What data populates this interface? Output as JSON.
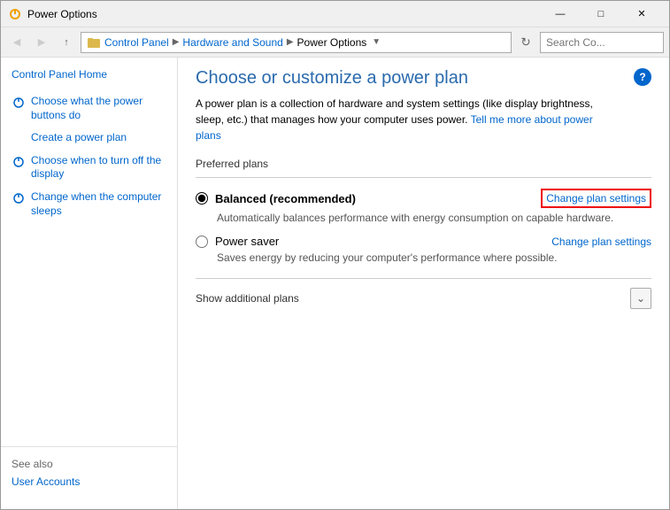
{
  "window": {
    "title": "Power Options",
    "titlebar_icon": "⚡",
    "controls": {
      "minimize": "—",
      "maximize": "□",
      "close": "✕"
    }
  },
  "toolbar": {
    "back_label": "◀",
    "forward_label": "▶",
    "up_label": "↑",
    "breadcrumb": [
      {
        "label": "Control Panel",
        "id": "control-panel"
      },
      {
        "label": "Hardware and Sound",
        "id": "hardware-sound"
      },
      {
        "label": "Power Options",
        "id": "power-options"
      }
    ],
    "search_placeholder": "Search Co...",
    "search_icon": "🔍"
  },
  "sidebar": {
    "home_label": "Control Panel Home",
    "nav_items": [
      {
        "id": "power-buttons",
        "label": "Choose what the power buttons do",
        "has_icon": true
      },
      {
        "id": "create-plan",
        "label": "Create a power plan",
        "has_icon": false
      },
      {
        "id": "turn-off-display",
        "label": "Choose when to turn off the display",
        "has_icon": true
      },
      {
        "id": "computer-sleeps",
        "label": "Change when the computer sleeps",
        "has_icon": true
      }
    ],
    "see_also_label": "See also",
    "see_also_links": [
      {
        "id": "user-accounts",
        "label": "User Accounts"
      }
    ]
  },
  "main": {
    "title": "Choose or customize a power plan",
    "description_part1": "A power plan is a collection of hardware and system settings (like display brightness, sleep, etc.) that manages how your computer uses power.",
    "description_link": "Tell me more about power plans",
    "preferred_plans_label": "Preferred plans",
    "plans": [
      {
        "id": "balanced",
        "name": "Balanced (recommended)",
        "description": "Automatically balances performance with energy consumption on capable hardware.",
        "change_link": "Change plan settings",
        "selected": true,
        "highlighted": true
      },
      {
        "id": "power-saver",
        "name": "Power saver",
        "description": "Saves energy by reducing your computer's performance where possible.",
        "change_link": "Change plan settings",
        "selected": false,
        "highlighted": false
      }
    ],
    "show_additional_label": "Show additional plans",
    "help_label": "?"
  }
}
